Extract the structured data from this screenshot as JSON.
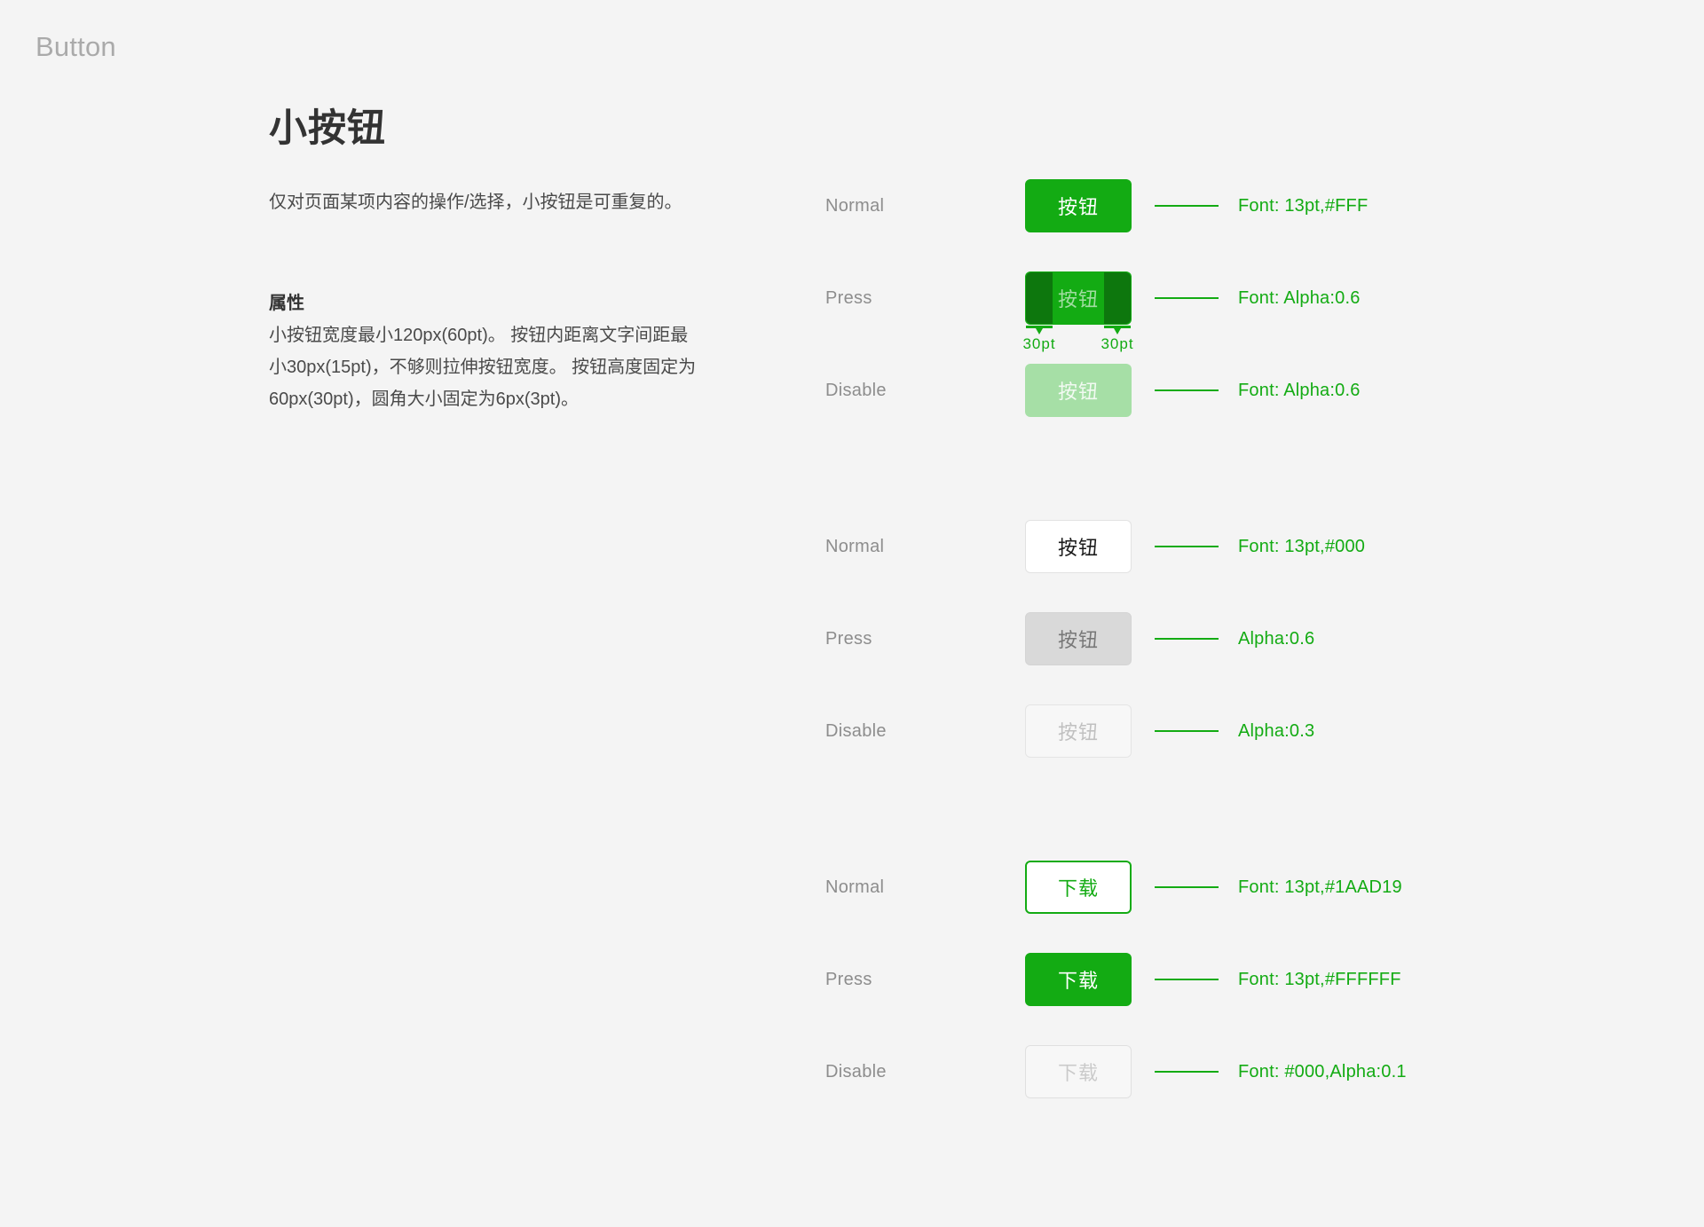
{
  "header": {
    "app_title": "Button"
  },
  "doc": {
    "title": "小按钮",
    "intro": "仅对页面某项内容的操作/选择，小按钮是可重复的。",
    "props_title": "属性",
    "props_body": "小按钮宽度最小120px(60pt)。\n按钮内距离文字间距最小30px(15pt)，不够则拉伸按钮宽度。\n按钮高度固定为60px(30pt)，圆角大小固定为6px(3pt)。"
  },
  "colors": {
    "brand_green": "#1AAD19",
    "page_background": "#F4F4F4"
  },
  "measure": {
    "left_label": "30pt",
    "right_label": "30pt"
  },
  "groups": [
    {
      "name": "primary-green-button",
      "rows": [
        {
          "state": "Normal",
          "button_label": "按钮",
          "annotation": "Font: 13pt,#FFF"
        },
        {
          "state": "Press",
          "button_label": "按钮",
          "annotation": "Font: Alpha:0.6"
        },
        {
          "state": "Disable",
          "button_label": "按钮",
          "annotation": "Font: Alpha:0.6"
        }
      ]
    },
    {
      "name": "secondary-white-button",
      "rows": [
        {
          "state": "Normal",
          "button_label": "按钮",
          "annotation": "Font: 13pt,#000"
        },
        {
          "state": "Press",
          "button_label": "按钮",
          "annotation": "Alpha:0.6"
        },
        {
          "state": "Disable",
          "button_label": "按钮",
          "annotation": "Alpha:0.3"
        }
      ]
    },
    {
      "name": "outline-download-button",
      "rows": [
        {
          "state": "Normal",
          "button_label": "下载",
          "annotation": "Font: 13pt,#1AAD19"
        },
        {
          "state": "Press",
          "button_label": "下载",
          "annotation": "Font: 13pt,#FFFFFF"
        },
        {
          "state": "Disable",
          "button_label": "下载",
          "annotation": "Font: #000,Alpha:0.1"
        }
      ]
    }
  ]
}
